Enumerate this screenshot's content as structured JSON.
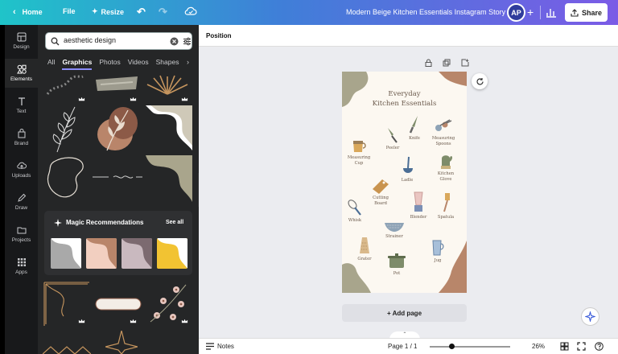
{
  "topbar": {
    "home_label": "Home",
    "file_label": "File",
    "resize_label": "Resize",
    "document_title": "Modern Beige Kitchen Essentials Instagram Story",
    "avatar_initials": "AP",
    "share_label": "Share"
  },
  "rail": {
    "items": [
      {
        "label": "Design",
        "icon": "design-icon"
      },
      {
        "label": "Elements",
        "icon": "elements-icon"
      },
      {
        "label": "Text",
        "icon": "text-icon"
      },
      {
        "label": "Brand",
        "icon": "brand-icon"
      },
      {
        "label": "Uploads",
        "icon": "uploads-icon"
      },
      {
        "label": "Draw",
        "icon": "draw-icon"
      },
      {
        "label": "Projects",
        "icon": "projects-icon"
      },
      {
        "label": "Apps",
        "icon": "apps-icon"
      }
    ],
    "active": "Elements"
  },
  "panel": {
    "search_value": "aesthetic design",
    "tabs": [
      "All",
      "Graphics",
      "Photos",
      "Videos",
      "Shapes"
    ],
    "active_tab": "Graphics",
    "magic_title": "Magic Recommendations",
    "see_all": "See all",
    "magic_colors": [
      "#a9a9a9",
      "#f2cfc0",
      "#c9b9bf",
      "#f2c332"
    ]
  },
  "canvas": {
    "position_label": "Position",
    "page_title_line1": "Everyday",
    "page_title_line2": "Kitchen Essentials",
    "items": [
      {
        "label": "Peeler",
        "icon": "peeler-icon"
      },
      {
        "label": "Knife",
        "icon": "knife-icon"
      },
      {
        "label": "Measuring Spoons",
        "icon": "measuring-spoons-icon"
      },
      {
        "label": "Measuring Cup",
        "icon": "measuring-cup-icon"
      },
      {
        "label": "Ladle",
        "icon": "ladle-icon"
      },
      {
        "label": "Kitchen Glove",
        "icon": "kitchen-glove-icon"
      },
      {
        "label": "Cutting Board",
        "icon": "cutting-board-icon"
      },
      {
        "label": "Whisk",
        "icon": "whisk-icon"
      },
      {
        "label": "Blender",
        "icon": "blender-icon"
      },
      {
        "label": "Spatula",
        "icon": "spatula-icon"
      },
      {
        "label": "Strainer",
        "icon": "strainer-icon"
      },
      {
        "label": "Grater",
        "icon": "grater-icon"
      },
      {
        "label": "Jug",
        "icon": "jug-icon"
      },
      {
        "label": "Pot",
        "icon": "pot-icon"
      }
    ],
    "add_page_label": "+ Add page"
  },
  "footer": {
    "notes_label": "Notes",
    "page_indicator": "Page 1 / 1",
    "zoom": "26%",
    "zoom_fraction": 0.27
  },
  "colors": {
    "topbar_start": "#1fc4c9",
    "topbar_end": "#7b5be6",
    "panel_bg": "#252627",
    "page_bg": "#fcf8f1",
    "blob_olive": "#a8a58c",
    "blob_terracotta": "#b8866a"
  }
}
